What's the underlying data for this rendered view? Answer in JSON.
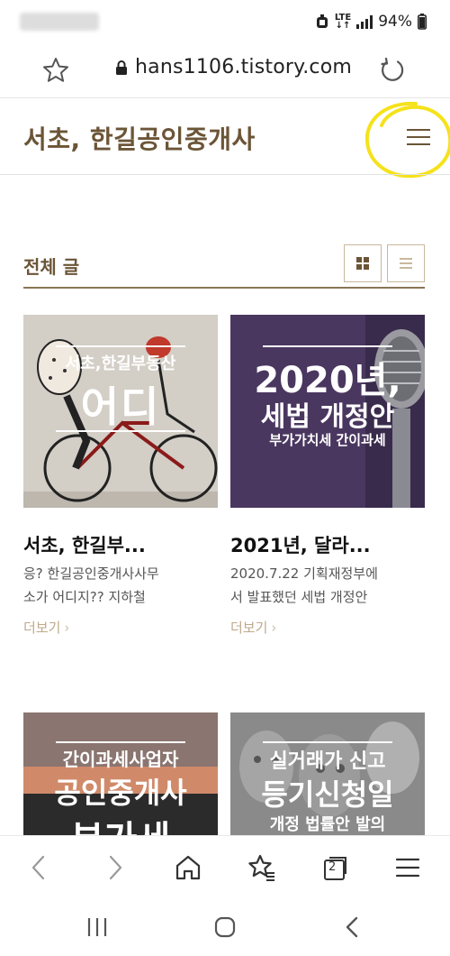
{
  "status_bar": {
    "network_top": "LTE",
    "network_bottom": "↓↑",
    "battery": "94%"
  },
  "browser": {
    "url": "hans1106.tistory.com",
    "icons": {
      "bookmark": "star-icon",
      "secure": "lock-icon",
      "reload": "reload-icon"
    }
  },
  "blog": {
    "title": "서초, 한길공인중개사",
    "menu_icon": "hamburger-menu-icon"
  },
  "section": {
    "title": "전체 글",
    "view_grid_icon": "grid-view-icon",
    "view_list_icon": "list-view-icon"
  },
  "posts": [
    {
      "image_text_top": "서초,한길부동산",
      "image_text_big": "어디",
      "title": "서초, 한길부...",
      "excerpt_line1": "응? 한길공인중개사사무",
      "excerpt_line2": "소가 어디지?? 지하철",
      "more": "더보기"
    },
    {
      "image_text_top": "2020년,",
      "image_text_big": "세법 개정안",
      "image_text_sub": "부가가치세 간이과세",
      "title": "2021년, 달라...",
      "excerpt_line1": "2020.7.22 기획재정부에",
      "excerpt_line2": "서 발표했던 세법 개정안",
      "more": "더보기"
    },
    {
      "image_text_top": "간이과세사업자",
      "image_text_big": "공인중개사",
      "image_text_sub": "부가세"
    },
    {
      "image_text_top": "실거래가 신고",
      "image_text_big": "등기신청일",
      "image_text_sub": "개정 법률안 발의"
    }
  ],
  "browser_nav": {
    "tab_count": "2",
    "icons": [
      "back-icon",
      "forward-icon",
      "home-icon",
      "bookmarks-icon",
      "tabs-icon",
      "menu-icon"
    ]
  },
  "system_nav": {
    "icons": [
      "recents-icon",
      "home-icon",
      "back-icon"
    ]
  },
  "colors": {
    "brand_brown": "#6b5537",
    "more_link": "#bfa98a",
    "highlight": "#f5e21a"
  }
}
